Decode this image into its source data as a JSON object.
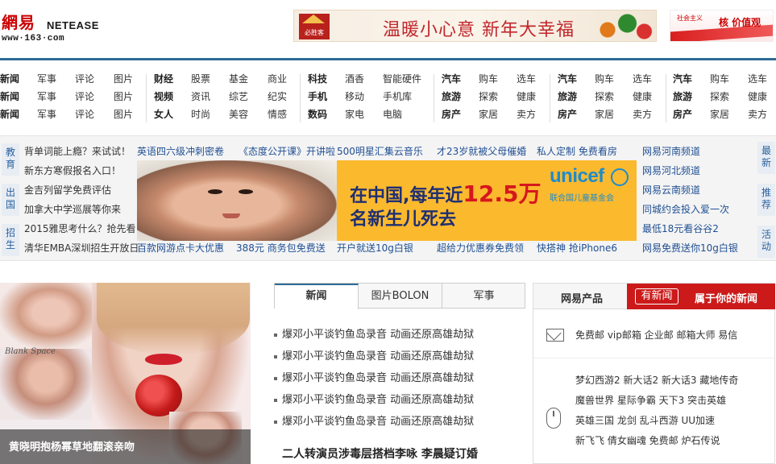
{
  "header": {
    "logo_cn": "網易",
    "logo_en": "NETEASE",
    "logo_url": "www·163·com",
    "top_ad_brand": "必胜客",
    "top_ad_text": "温暖小心意 新年大幸福",
    "side_ad_small": "社会主义",
    "side_ad_big": "核 价值观"
  },
  "nav": {
    "rows": [
      [
        "新闻",
        "军事",
        "评论",
        "图片",
        "财经",
        "股票",
        "基金",
        "商业",
        "科技",
        "酒香",
        "智能硬件",
        "汽车",
        "购车",
        "选车",
        "汽车",
        "购车",
        "选车",
        "汽车",
        "购车",
        "选车"
      ],
      [
        "新闻",
        "军事",
        "评论",
        "图片",
        "视频",
        "资讯",
        "综艺",
        "纪实",
        "手机",
        "移动",
        "手机库",
        "旅游",
        "探索",
        "健康",
        "旅游",
        "探索",
        "健康",
        "旅游",
        "探索",
        "健康"
      ],
      [
        "新闻",
        "军事",
        "评论",
        "图片",
        "女人",
        "时尚",
        "美容",
        "情感",
        "数码",
        "家电",
        "电脑",
        "房产",
        "家居",
        "卖方",
        "房产",
        "家居",
        "卖方",
        "房产",
        "家居",
        "卖方"
      ]
    ]
  },
  "promo": {
    "left_tabs": [
      "教育",
      "出国",
      "招生"
    ],
    "right_tabs": [
      "最新",
      "推荐",
      "活动"
    ],
    "col1": [
      "背单词能上瘾？来试试！",
      "新东方寒假报名入口！",
      "金吉列留学免费评估",
      "加拿大中学巡展等你来",
      "2015雅思考什么？抢先看",
      "清华EMBA深圳招生开放日"
    ],
    "top_row": [
      "英语四六级冲刺密卷",
      "《态度公开课》开讲啦",
      "500明星汇集云音乐",
      "才23岁就被父母催婚",
      "私人定制 免费看房"
    ],
    "bottom_row": [
      "百款网游点卡大优惠",
      "388元 商务包免费送",
      "开户就送10g白银",
      "超给力优惠券免费领",
      "快搭神 抢iPhone6"
    ],
    "col_right": [
      "网易河南频道",
      "网易河北频道",
      "网易云南频道",
      "同城约会投入爱一次",
      "最低18元看谷谷2",
      "网易免费送你10g白银"
    ],
    "banner": {
      "line1_a": "在中国,每年近",
      "line1_b": "12.5万",
      "line2": "名新生儿死去",
      "logo": "unicef",
      "logo_cn": "联合国儿童基金会"
    }
  },
  "feature": {
    "caption": "黄晓明抱杨幂草地翻滚亲吻",
    "scrawl": "Blank Space"
  },
  "tabs": [
    "新闻",
    "图片BOLON",
    "军事"
  ],
  "news": {
    "items": [
      "爆邓小平谈钓鱼岛录音 动画还原高雄劫狱",
      "爆邓小平谈钓鱼岛录音 动画还原高雄劫狱",
      "爆邓小平谈钓鱼岛录音 动画还原高雄劫狱",
      "爆邓小平谈钓鱼岛录音 动画还原高雄劫狱",
      "爆邓小平谈钓鱼岛录音 动画还原高雄劫狱"
    ],
    "headline": "二人转演员涉毒层搭档李咏 李晨疑订婚"
  },
  "products": {
    "title": "网易产品",
    "badge_word": "有新闻",
    "slogan": "属于你的新闻",
    "mail_line": "免费邮 vip邮箱 企业邮 邮箱大师 易信",
    "game_lines": [
      "梦幻西游2 新大话2 新大话3 藏地传奇",
      "魔兽世界 星际争霸 天下3 突击英雄",
      "英雄三国 龙剑 乱斗西游 UU加速",
      "新飞飞 倩女幽魂 免费邮 炉石传说"
    ]
  }
}
